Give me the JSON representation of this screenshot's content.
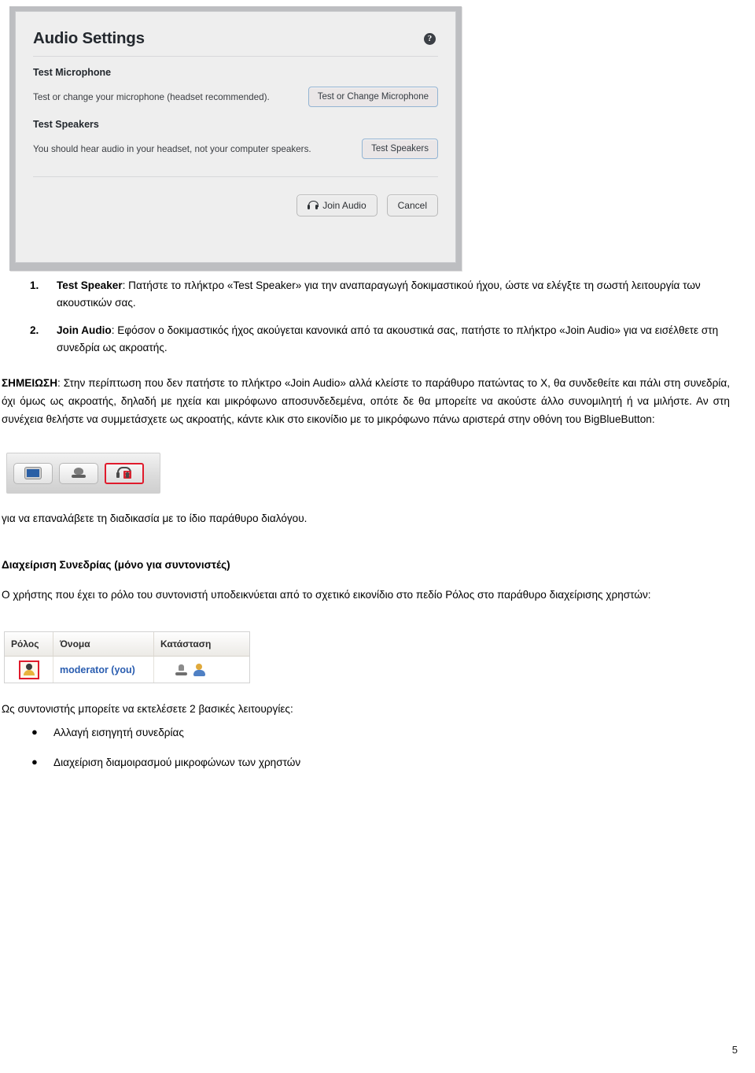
{
  "dialog": {
    "title": "Audio Settings",
    "help_icon": "help-circle-icon",
    "sections": [
      {
        "heading": "Test Microphone",
        "description": "Test or change your microphone (headset recommended).",
        "button": "Test or Change Microphone"
      },
      {
        "heading": "Test Speakers",
        "description": "You should hear audio in your headset, not your computer speakers.",
        "button": "Test Speakers"
      }
    ],
    "footer": {
      "join_label": "Join Audio",
      "join_icon": "headset-icon",
      "cancel_label": "Cancel"
    },
    "colors": {
      "frame": "#bdbec1",
      "body": "#eeeeee",
      "button_border_blue": "#93b4d3",
      "title_text": "#23282e"
    }
  },
  "document": {
    "numbered_list": [
      {
        "num": "1.",
        "bold": "Test Speaker",
        "text": ": Πατήστε το πλήκτρο «Test Speaker» για την αναπαραγωγή δοκιμαστικού ήχου, ώστε να ελέγξτε τη σωστή λειτουργία των ακουστικών σας."
      },
      {
        "num": "2.",
        "bold": "Join Audio",
        "text": ": Εφόσον ο δοκιμαστικός ήχος ακούγεται κανονικά από τα ακουστικά σας, πατήστε το πλήκτρο «Join Audio» για να εισέλθετε στη συνεδρία ως ακροατής."
      }
    ],
    "note": {
      "label": "ΣΗΜΕΙΩΣΗ",
      "text": ": Στην περίπτωση που δεν πατήστε το πλήκτρο «Join Audio» αλλά κλείστε το παράθυρο πατώντας το Χ, θα συνδεθείτε και πάλι στη συνεδρία, όχι όμως ως ακροατής, δηλαδή με ηχεία και μικρόφωνο αποσυνδεδεμένα, οπότε δε θα μπορείτε να ακούστε άλλο συνομιλητή ή να μιλήστε. Αν στη συνέχεια θελήστε να συμμετάσχετε ως ακροατής, κάντε κλικ στο εικονίδιο με το μικρόφωνο πάνω αριστερά στην οθόνη του BigBlueButton:"
    },
    "toolbar": {
      "buttons": [
        {
          "icon": "screen-share-icon",
          "active": false
        },
        {
          "icon": "webcam-icon",
          "active": false
        },
        {
          "icon": "headset-muted-icon",
          "active": true,
          "badge": "✕"
        }
      ]
    },
    "repeat_para": "για να επαναλάβετε τη διαδικασία με το ίδιο παράθυρο διαλόγου.",
    "section_heading": "Διαχείριση Συνεδρίας (μόνο για συντονιστές)",
    "role_para": "Ο χρήστης που έχει το ρόλο του συντονιστή υποδεικνύεται από το σχετικό εικονίδιο στο πεδίο Ρόλος στο παράθυρο διαχείρισης χρηστών:",
    "user_table": {
      "columns": [
        "Ρόλος",
        "Όνομα",
        "Κατάσταση"
      ],
      "rows": [
        {
          "role_icon": "moderator-role-icon",
          "name": "moderator (you)",
          "status_icons": [
            "microphone-icon",
            "presenter-icon"
          ]
        }
      ]
    },
    "ways_para": "Ως συντονιστής μπορείτε να εκτελέσετε 2 βασικές λειτουργίες:",
    "bullets": [
      "Αλλαγή εισηγητή συνεδρίας",
      "Διαχείριση διαμοιρασμού μικροφώνων των χρηστών"
    ],
    "bullet_marker": "●",
    "page_number": "5"
  }
}
